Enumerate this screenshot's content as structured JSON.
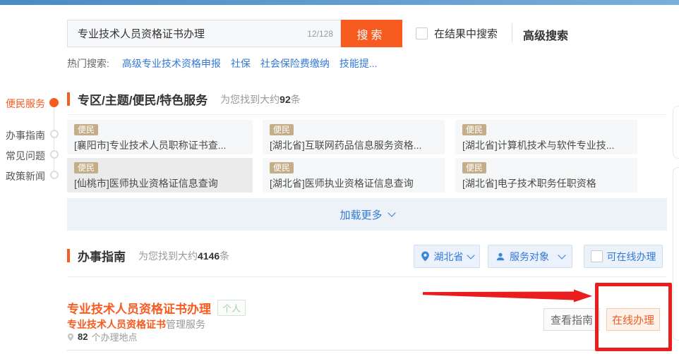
{
  "colors": {
    "accent_orange": "#f75b1f",
    "link_blue": "#3478d6",
    "badge_tan": "#c4ad89",
    "annotation_red": "#e91d1d",
    "topbar_gradient": [
      "#4a8bc4",
      "#79aeda"
    ]
  },
  "search": {
    "value": "专业技术人员资格证书办理",
    "counter": "12/128",
    "button_label": "搜索",
    "in_results_label": "在结果中搜索",
    "advanced_label": "高级搜索"
  },
  "hot": {
    "label": "热门搜索:",
    "links": [
      "高级专业技术资格申报",
      "社保",
      "社会保险费缴纳",
      "技能提..."
    ]
  },
  "sidebar": {
    "items": [
      {
        "label": "便民服务",
        "active": true
      },
      {
        "label": "办事指南",
        "active": false
      },
      {
        "label": "常见问题",
        "active": false
      },
      {
        "label": "政策新闻",
        "active": false
      }
    ]
  },
  "services": {
    "title": "专区/主题/便民/特色服务",
    "count_prefix": "为您找到大约",
    "count": "92",
    "count_suffix": "条",
    "cards": [
      {
        "badge": "便民",
        "title": "[襄阳市]专业技术人员职称证书查..."
      },
      {
        "badge": "便民",
        "title": "[湖北省]互联网药品信息服务资格..."
      },
      {
        "badge": "便民",
        "title": "[湖北省]计算机技术与软件专业技..."
      },
      {
        "badge": "便民",
        "title": "[仙桃市]医师执业资格证信息查询"
      },
      {
        "badge": "便民",
        "title": "[湖北省]医师执业资格证信息查询"
      },
      {
        "badge": "便民",
        "title": "[湖北省]电子技术职务任职资格"
      }
    ],
    "load_more": "加载更多"
  },
  "guides": {
    "title": "办事指南",
    "count_prefix": "为您找到大约",
    "count": "4146",
    "count_suffix": "条",
    "filters": {
      "region": "湖北省",
      "audience": "服务对象",
      "online": "可在线办理"
    }
  },
  "result": {
    "title": "专业技术人员资格证书办理",
    "tag": "个人",
    "subtitle_highlight": "专业技术人员资格证书",
    "subtitle_rest": "管理服务",
    "locations_count": "82",
    "locations_suffix": "个办理地点",
    "view_guide_label": "查看指南",
    "online_label": "在线办理"
  }
}
